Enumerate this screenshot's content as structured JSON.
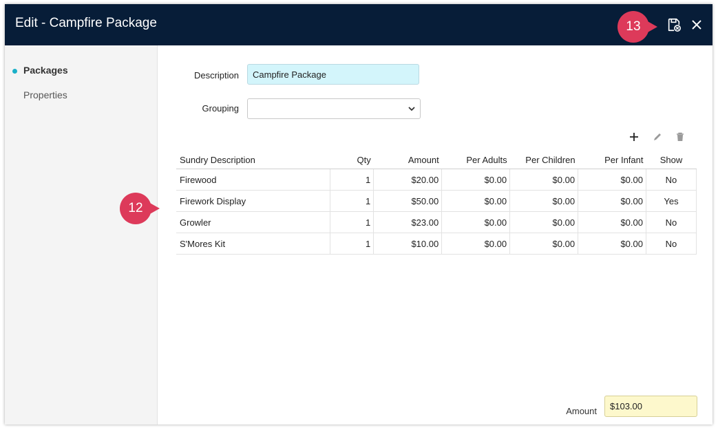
{
  "header": {
    "title": "Edit - Campfire Package"
  },
  "sidebar": {
    "items": [
      {
        "label": "Packages"
      },
      {
        "label": "Properties"
      }
    ]
  },
  "form": {
    "description_label": "Description",
    "description_value": "Campfire Package",
    "grouping_label": "Grouping",
    "grouping_value": ""
  },
  "toolbar": {
    "add": "add-icon",
    "edit": "pencil-icon",
    "delete": "trash-icon"
  },
  "table": {
    "columns": [
      "Sundry Description",
      "Qty",
      "Amount",
      "Per Adults",
      "Per Children",
      "Per Infant",
      "Show"
    ],
    "rows": [
      [
        "Firewood",
        "1",
        "$20.00",
        "$0.00",
        "$0.00",
        "$0.00",
        "No"
      ],
      [
        "Firework Display",
        "1",
        "$50.00",
        "$0.00",
        "$0.00",
        "$0.00",
        "Yes"
      ],
      [
        "Growler",
        "1",
        "$23.00",
        "$0.00",
        "$0.00",
        "$0.00",
        "No"
      ],
      [
        "S'Mores Kit",
        "1",
        "$10.00",
        "$0.00",
        "$0.00",
        "$0.00",
        "No"
      ]
    ]
  },
  "footer": {
    "amount_label": "Amount",
    "amount_value": "$103.00"
  },
  "callouts": {
    "top": "13",
    "table": "12"
  },
  "colors": {
    "header_bg": "#071d38",
    "accent": "#1ab0c8",
    "callout": "#dd3a5a"
  }
}
